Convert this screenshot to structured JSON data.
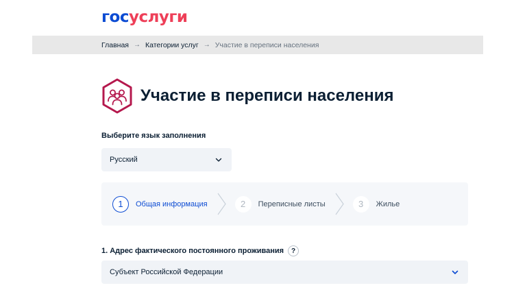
{
  "logo": {
    "part1": "гос",
    "part2": "услуги"
  },
  "breadcrumbs": [
    {
      "label": "Главная"
    },
    {
      "label": "Категории услуг"
    },
    {
      "label": "Участие в переписи населения"
    }
  ],
  "breadcrumb_separator": "→",
  "page": {
    "title": "Участие в переписи населения",
    "icon": "census-people-hexagon-icon"
  },
  "language": {
    "label": "Выберите язык заполнения",
    "selected": "Русский"
  },
  "stepper": {
    "steps": [
      {
        "number": "1",
        "label": "Общая информация",
        "state": "active"
      },
      {
        "number": "2",
        "label": "Переписные листы",
        "state": "inactive"
      },
      {
        "number": "3",
        "label": "Жилье",
        "state": "inactive"
      }
    ]
  },
  "address": {
    "label": "1. Адрес фактического постоянного проживания",
    "help": "?",
    "subject_select": "Субъект Российской Федерации"
  },
  "colors": {
    "brand_blue": "#0d4cd3",
    "brand_red": "#ee3f58",
    "icon_magenta": "#b5184d",
    "field_bg": "#f0f3f7"
  }
}
